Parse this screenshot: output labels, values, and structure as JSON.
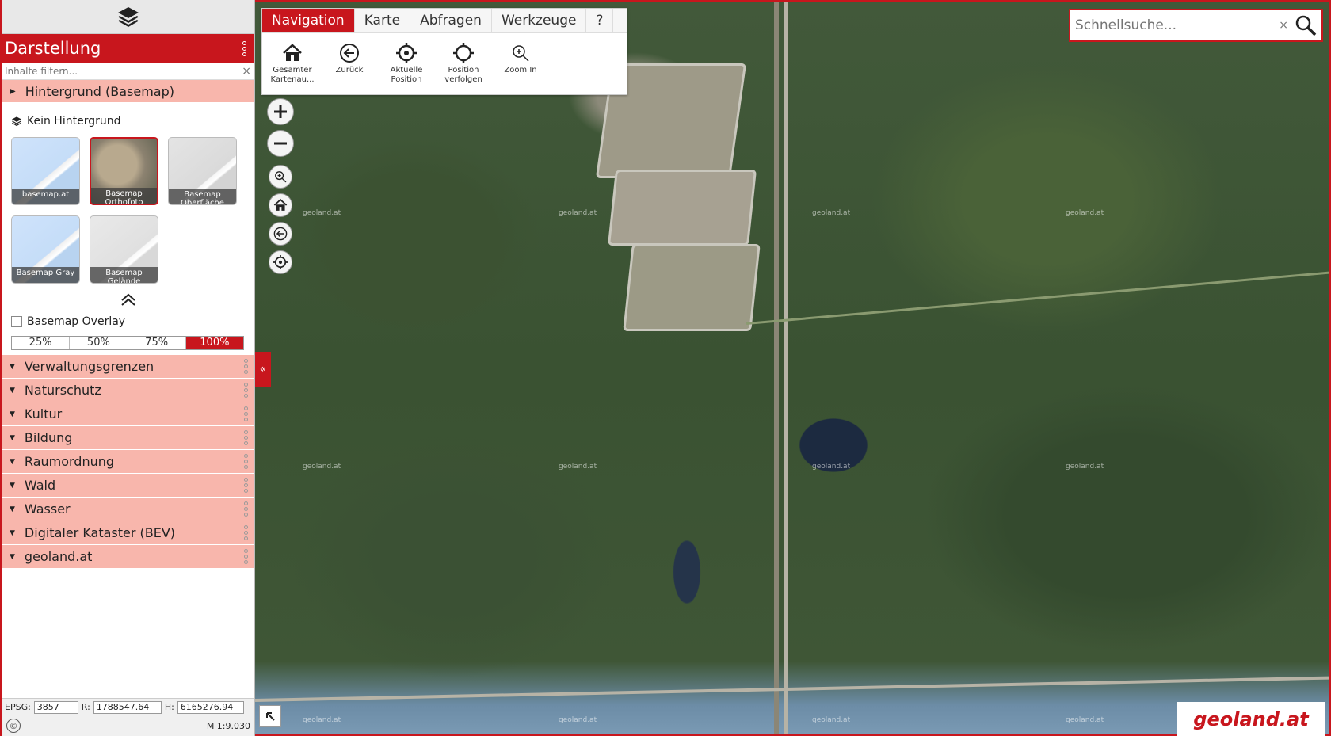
{
  "sidebar": {
    "panel_title": "Darstellung",
    "filter_placeholder": "Inhalte filtern...",
    "basemap_group": "Hintergrund (Basemap)",
    "no_background": "Kein Hintergrund",
    "tiles": [
      {
        "label": "basemap.at",
        "style": "blue",
        "selected": false
      },
      {
        "label": "Basemap Orthofoto",
        "style": "ortho",
        "selected": true
      },
      {
        "label": "Basemap Oberfläche",
        "style": "grey",
        "selected": false
      },
      {
        "label": "Basemap Gray",
        "style": "gray2",
        "selected": false
      },
      {
        "label": "Basemap Gelände",
        "style": "terrain",
        "selected": false
      }
    ],
    "overlay_label": "Basemap Overlay",
    "opacity_options": [
      "25%",
      "50%",
      "75%",
      "100%"
    ],
    "opacity_selected": "100%",
    "groups": [
      "Verwaltungsgrenzen",
      "Naturschutz",
      "Kultur",
      "Bildung",
      "Raumordnung",
      "Wald",
      "Wasser",
      "Digitaler Kataster (BEV)",
      "geoland.at"
    ],
    "coords": {
      "epsg_label": "EPSG:",
      "epsg": "3857",
      "r_label": "R:",
      "r": "1788547.64",
      "h_label": "H:",
      "h": "6165276.94"
    },
    "scale": "M 1:9.030",
    "copyright": "©"
  },
  "nav": {
    "tabs": [
      "Navigation",
      "Karte",
      "Abfragen",
      "Werkzeuge",
      "?"
    ],
    "active_tab": "Navigation",
    "tools": [
      {
        "label": "Gesamter Kartenau...",
        "icon": "home-icon"
      },
      {
        "label": "Zurück",
        "icon": "back-icon"
      },
      {
        "label": "Aktuelle Position",
        "icon": "crosshair-icon"
      },
      {
        "label": "Position verfolgen",
        "icon": "crosshair-follow-icon"
      },
      {
        "label": "Zoom In",
        "icon": "zoom-in-icon"
      }
    ]
  },
  "search": {
    "placeholder": "Schnellsuche...",
    "clear": "×"
  },
  "map": {
    "watermark": "geoland.at",
    "logo": "geoland.at"
  },
  "colors": {
    "accent": "#c8161d",
    "group_bg": "#f8b6ac"
  }
}
